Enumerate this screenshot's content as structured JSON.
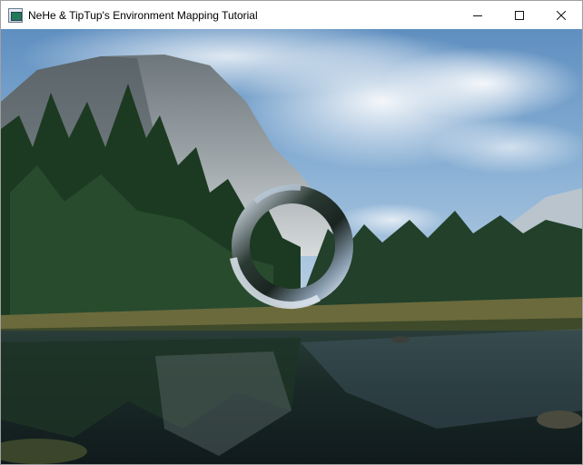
{
  "window": {
    "title": "NeHe & TipTup's Environment Mapping Tutorial",
    "icon": "app-window-icon"
  },
  "caption_buttons": {
    "minimize_icon": "minimize-icon",
    "maximize_icon": "maximize-icon",
    "close_icon": "close-icon"
  },
  "scene": {
    "background": "Yosemite valley landscape environment map",
    "object": "environment-mapped torus",
    "colors": {
      "sky": "#6f9cc8",
      "cloud": "#e8eef4",
      "cliff": "#9aa3a8",
      "forest": "#1f3a24",
      "water": "#1b2a2c",
      "torus_light": "#c9d6e6",
      "torus_dark": "#1a2420"
    }
  }
}
